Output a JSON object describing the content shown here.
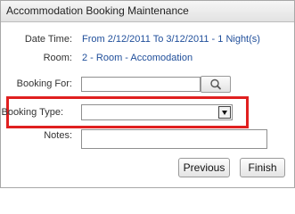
{
  "window": {
    "title": "Accommodation Booking Maintenance"
  },
  "fields": {
    "date_time_label": "Date Time:",
    "date_time_value": "From 2/12/2011 To 3/12/2011 - 1 Night(s)",
    "room_label": "Room:",
    "room_value": "2 - Room - Accomodation",
    "booking_for_label": "Booking For:",
    "booking_for_value": "",
    "booking_type_label": "Booking Type:",
    "booking_type_value": "",
    "notes_label": "Notes:",
    "notes_value": ""
  },
  "buttons": {
    "previous": "Previous",
    "finish": "Finish"
  },
  "icons": {
    "lookup": "search-icon",
    "dropdown": "chevron-down-icon"
  },
  "colors": {
    "value_text": "#1f4e9a",
    "highlight": "#e02020"
  }
}
